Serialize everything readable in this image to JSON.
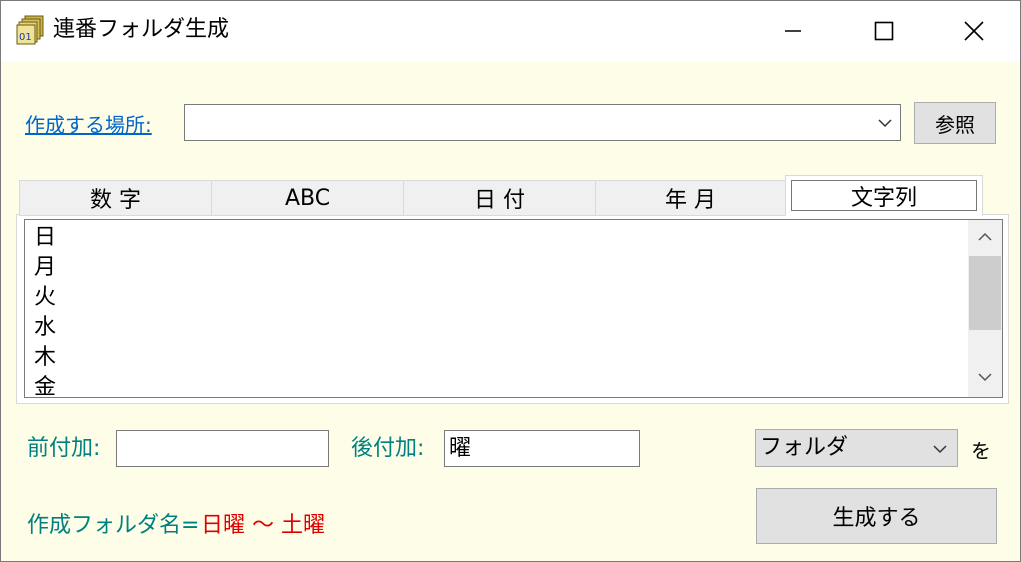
{
  "window": {
    "title": "連番フォルダ生成",
    "icon_text": "01"
  },
  "location": {
    "label": "作成する場所:",
    "value": "",
    "browse_label": "参照"
  },
  "tabs": [
    {
      "label": "数 字"
    },
    {
      "label": "ABC"
    },
    {
      "label": "日 付"
    },
    {
      "label": "年 月"
    },
    {
      "label": "文字列",
      "selected": true
    }
  ],
  "list": {
    "items": [
      "日",
      "月",
      "火",
      "水",
      "木",
      "金"
    ]
  },
  "affix": {
    "prefix_label": "前付加:",
    "prefix_value": "",
    "suffix_label": "後付加:",
    "suffix_value": "曜"
  },
  "target": {
    "selected": "フォルダ",
    "particle": "を"
  },
  "result": {
    "label": "作成フォルダ名=",
    "value": "日曜 〜 土曜"
  },
  "generate_label": "生成する",
  "colors": {
    "background": "#fdfde8",
    "link": "#0066cc",
    "teal": "#008080",
    "result": "#e00000"
  }
}
